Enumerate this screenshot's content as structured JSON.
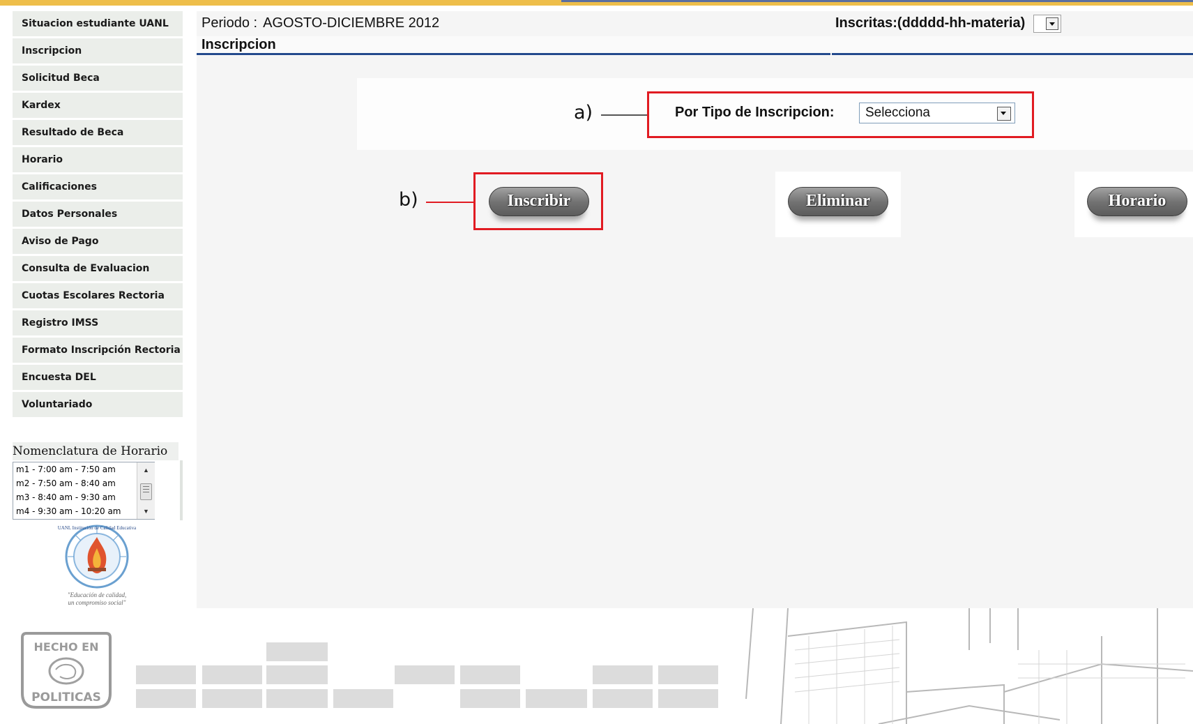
{
  "sidebar": {
    "items": [
      {
        "label": "Situacion estudiante UANL"
      },
      {
        "label": "Inscripcion"
      },
      {
        "label": "Solicitud Beca"
      },
      {
        "label": "Kardex"
      },
      {
        "label": "Resultado de Beca"
      },
      {
        "label": "Horario"
      },
      {
        "label": "Calificaciones"
      },
      {
        "label": "Datos Personales"
      },
      {
        "label": "Aviso de Pago"
      },
      {
        "label": "Consulta de Evaluacion"
      },
      {
        "label": "Cuotas Escolares Rectoria"
      },
      {
        "label": "Registro IMSS"
      },
      {
        "label": "Formato Inscripción Rectoria"
      },
      {
        "label": "Encuesta DEL"
      },
      {
        "label": "Voluntariado"
      }
    ]
  },
  "nomenclatura": {
    "title": "Nomenclatura de Horario",
    "options": [
      "m1 - 7:00 am - 7:50 am",
      "m2 - 7:50 am - 8:40 am",
      "m3 - 8:40 am - 9:30 am",
      "m4 - 9:30 am - 10:20 am"
    ]
  },
  "seal": {
    "ring_text": "UANL Institución de Calidad Educativa",
    "motto_line1": "\"Educación de calidad,",
    "motto_line2": "un compromiso social\""
  },
  "header": {
    "period_label": "Periodo :",
    "period_value": "AGOSTO-DICIEMBRE 2012",
    "inscritas_label": "Inscritas:(ddddd-hh-materia)",
    "inscritas_value": "",
    "section_title": "Inscripcion"
  },
  "annotations": {
    "a": "a)",
    "b": "b)"
  },
  "filter": {
    "label": "Por Tipo de Inscripcion:",
    "selected": "Selecciona"
  },
  "actions": {
    "inscribir": "Inscribir",
    "eliminar": "Eliminar",
    "horario": "Horario"
  },
  "footer": {
    "stamp_top": "HECHO EN",
    "stamp_bottom": "POLITICAS"
  },
  "colors": {
    "top_bar": "#eebe4a",
    "rule": "#234a8d",
    "annotation_red": "#e11b22"
  }
}
